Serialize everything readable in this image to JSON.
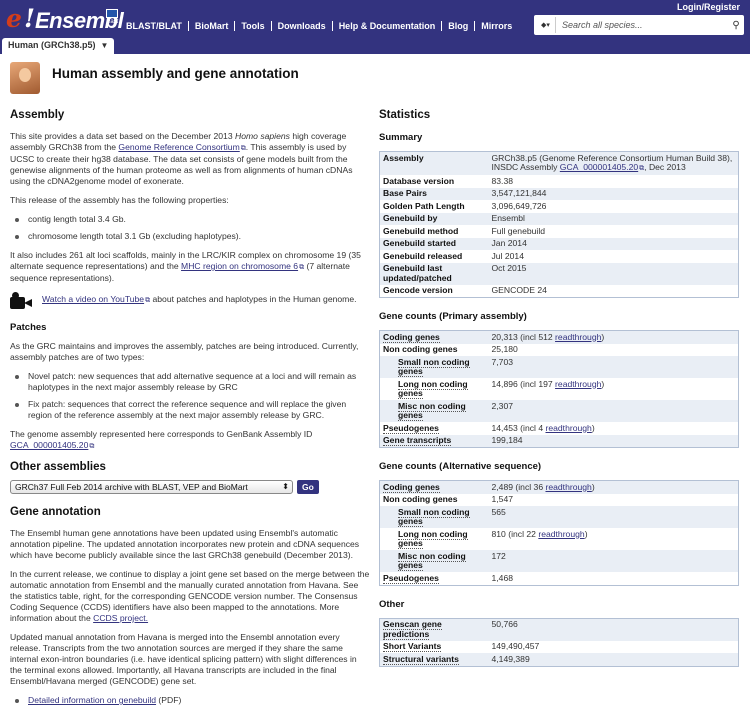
{
  "header": {
    "logo_e": "e",
    "logo_bang": "!",
    "logo_word": "Ensembl",
    "logo_flag_label": "east",
    "nav": [
      "BLAST/BLAT",
      "BioMart",
      "Tools",
      "Downloads",
      "Help & Documentation",
      "Blog",
      "Mirrors"
    ],
    "login": "Login/Register",
    "search_placeholder": "Search all species...",
    "tab_label": "Human (GRCh38.p5)"
  },
  "page": {
    "title": "Human assembly and gene annotation"
  },
  "left": {
    "assembly_heading": "Assembly",
    "assembly_p1_a": "This site provides a data set based on the December 2013 ",
    "assembly_p1_species": "Homo sapiens",
    "assembly_p1_b": " high coverage assembly GRCh38 from the ",
    "assembly_p1_link": "Genome Reference Consortium",
    "assembly_p1_c": ". This assembly is used by UCSC to create their hg38 database. The data set consists of gene models built from the genewise alignments of the human proteome as well as from alignments of human cDNAs using the cDNA2genome model of exonerate.",
    "assembly_p2": "This release of the assembly has the following properties:",
    "properties": [
      "contig length total 3.4 Gb.",
      "chromosome length total 3.1 Gb (excluding haplotypes)."
    ],
    "assembly_p3_a": "It also includes 261 alt loci scaffolds, mainly in the LRC/KIR complex on chromosome 19 (35 alternate sequence representations) and the ",
    "assembly_p3_link": "MHC region on chromosome 6",
    "assembly_p3_b": " (7 alternate sequence representations).",
    "video_link": "Watch a video on YouTube",
    "video_text": " about patches and haplotypes in the Human genome.",
    "patches_heading": "Patches",
    "patches_p1": "As the GRC maintains and improves the assembly, patches are being introduced. Currently, assembly patches are of two types:",
    "patch_types": [
      "Novel patch: new sequences that add alternative sequence at a loci and will remain as haplotypes in the next major assembly release by GRC",
      "Fix patch: sequences that correct the reference sequence and will replace the given region of the reference assembly at the next major assembly release by GRC."
    ],
    "patches_p2": "The genome assembly represented here corresponds to GenBank Assembly ID ",
    "patches_p2_link": "GCA_000001405.20",
    "other_heading": "Other assemblies",
    "other_select": "GRCh37 Full Feb 2014 archive with BLAST, VEP and BioMart",
    "go_label": "Go",
    "gene_heading": "Gene annotation",
    "gene_p1": "The Ensembl human gene annotations have been updated using Ensembl's automatic annotation pipeline. The updated annotation incorporates new protein and cDNA sequences which have become publicly available since the last GRCh38 genebuild (December 2013).",
    "gene_p2_a": "In the current release, we continue to display a joint gene set based on the merge between the automatic annotation from Ensembl and the manually curated annotation from Havana. See the statistics table, right, for the corresponding GENCODE version number. The Consensus Coding Sequence (CCDS) identifiers have also been mapped to the annotations. More information about the ",
    "gene_p2_link": "CCDS project.",
    "gene_p3": "Updated manual annotation from Havana is merged into the Ensembl annotation every release. Transcripts from the two annotation sources are merged if they share the same internal exon-intron boundaries (i.e. have identical splicing pattern) with slight differences in the terminal exons allowed. Importantly, all Havana transcripts are included in the final Ensembl/Havana merged (GENCODE) gene set.",
    "genebuild_link": "Detailed information on genebuild",
    "genebuild_suffix": " (PDF)"
  },
  "right": {
    "statistics_heading": "Statistics",
    "summary_heading": "Summary",
    "summary": [
      {
        "k": "Assembly",
        "v": "GRCh38.p5 (Genome Reference Consortium Human Build 38), INSDC Assembly ",
        "link": "GCA_000001405.20",
        "tail": ", Dec 2013"
      },
      {
        "k": "Database version",
        "v": "83.38"
      },
      {
        "k": "Base Pairs",
        "v": "3,547,121,844"
      },
      {
        "k": "Golden Path Length",
        "v": "3,096,649,726"
      },
      {
        "k": "Genebuild by",
        "v": "Ensembl"
      },
      {
        "k": "Genebuild method",
        "v": "Full genebuild"
      },
      {
        "k": "Genebuild started",
        "v": "Jan 2014"
      },
      {
        "k": "Genebuild released",
        "v": "Jul 2014"
      },
      {
        "k": "Genebuild last updated/patched",
        "v": "Oct 2015"
      },
      {
        "k": "Gencode version",
        "v": "GENCODE 24"
      }
    ],
    "primary_heading": "Gene counts (Primary assembly)",
    "primary": [
      {
        "k": "Coding genes",
        "v": "20,313 (incl 512 ",
        "link": "readthrough",
        "tail": ")",
        "dotted": true
      },
      {
        "k": "Non coding genes",
        "v": "25,180"
      },
      {
        "k": "Small non coding genes",
        "v": "7,703",
        "sub": true,
        "dotted": true
      },
      {
        "k": "Long non coding genes",
        "v": "14,896 (incl 197 ",
        "link": "readthrough",
        "tail": ")",
        "sub": true,
        "dotted": true
      },
      {
        "k": "Misc non coding genes",
        "v": "2,307",
        "sub": true,
        "dotted": true
      },
      {
        "k": "Pseudogenes",
        "v": "14,453 (incl 4 ",
        "link": "readthrough",
        "tail": ")",
        "dotted": true
      },
      {
        "k": "Gene transcripts",
        "v": "199,184",
        "dotted": true
      }
    ],
    "alt_heading": "Gene counts (Alternative sequence)",
    "alt": [
      {
        "k": "Coding genes",
        "v": "2,489 (incl 36 ",
        "link": "readthrough",
        "tail": ")",
        "dotted": true
      },
      {
        "k": "Non coding genes",
        "v": "1,547"
      },
      {
        "k": "Small non coding genes",
        "v": "565",
        "sub": true,
        "dotted": true
      },
      {
        "k": "Long non coding genes",
        "v": "810 (incl 22 ",
        "link": "readthrough",
        "tail": ")",
        "sub": true,
        "dotted": true
      },
      {
        "k": "Misc non coding genes",
        "v": "172",
        "sub": true,
        "dotted": true
      },
      {
        "k": "Pseudogenes",
        "v": "1,468",
        "dotted": true
      }
    ],
    "other_heading": "Other",
    "other": [
      {
        "k": "Genscan gene predictions",
        "v": "50,766",
        "dotted": true
      },
      {
        "k": "Short Variants",
        "v": "149,490,457",
        "dotted": true
      },
      {
        "k": "Structural variants",
        "v": "4,149,389",
        "dotted": true
      }
    ]
  }
}
